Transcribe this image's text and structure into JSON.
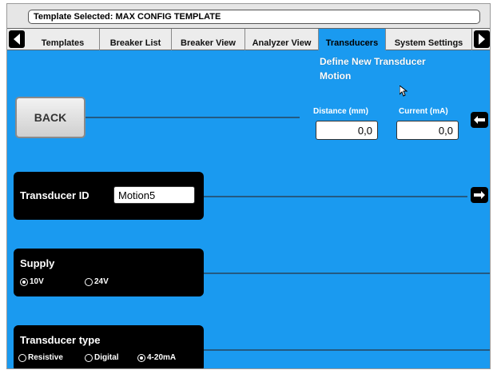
{
  "template_bar": {
    "text": "Template Selected: MAX CONFIG TEMPLATE"
  },
  "tabs": [
    {
      "label": "Templates",
      "active": false
    },
    {
      "label": "Breaker List",
      "active": false
    },
    {
      "label": "Breaker View",
      "active": false
    },
    {
      "label": "Analyzer View",
      "active": false
    },
    {
      "label": "Transducers",
      "active": true
    },
    {
      "label": "System Settings",
      "active": false
    }
  ],
  "page": {
    "title_line1": "Define New Transducer",
    "title_line2": "Motion"
  },
  "back_button": {
    "label": "BACK"
  },
  "distance": {
    "label": "Distance (mm)",
    "value": "0,0"
  },
  "current": {
    "label": "Current (mA)",
    "value": "0,0"
  },
  "transducer_id": {
    "label": "Transducer ID",
    "value": "Motion5"
  },
  "supply": {
    "label": "Supply",
    "options": [
      {
        "label": "10V",
        "selected": true
      },
      {
        "label": "24V",
        "selected": false
      }
    ]
  },
  "transducer_type": {
    "label": "Transducer type",
    "options": [
      {
        "label": "Resistive",
        "selected": false
      },
      {
        "label": "Digital",
        "selected": false
      },
      {
        "label": "4-20mA",
        "selected": true
      }
    ]
  },
  "colors": {
    "content_background": "#1a9af0",
    "panel_background": "#000000",
    "line_color": "#235a82"
  },
  "icons": [
    "chevron-left-icon",
    "chevron-right-icon",
    "arrow-left-icon",
    "arrow-right-icon",
    "mouse-pointer-icon"
  ]
}
